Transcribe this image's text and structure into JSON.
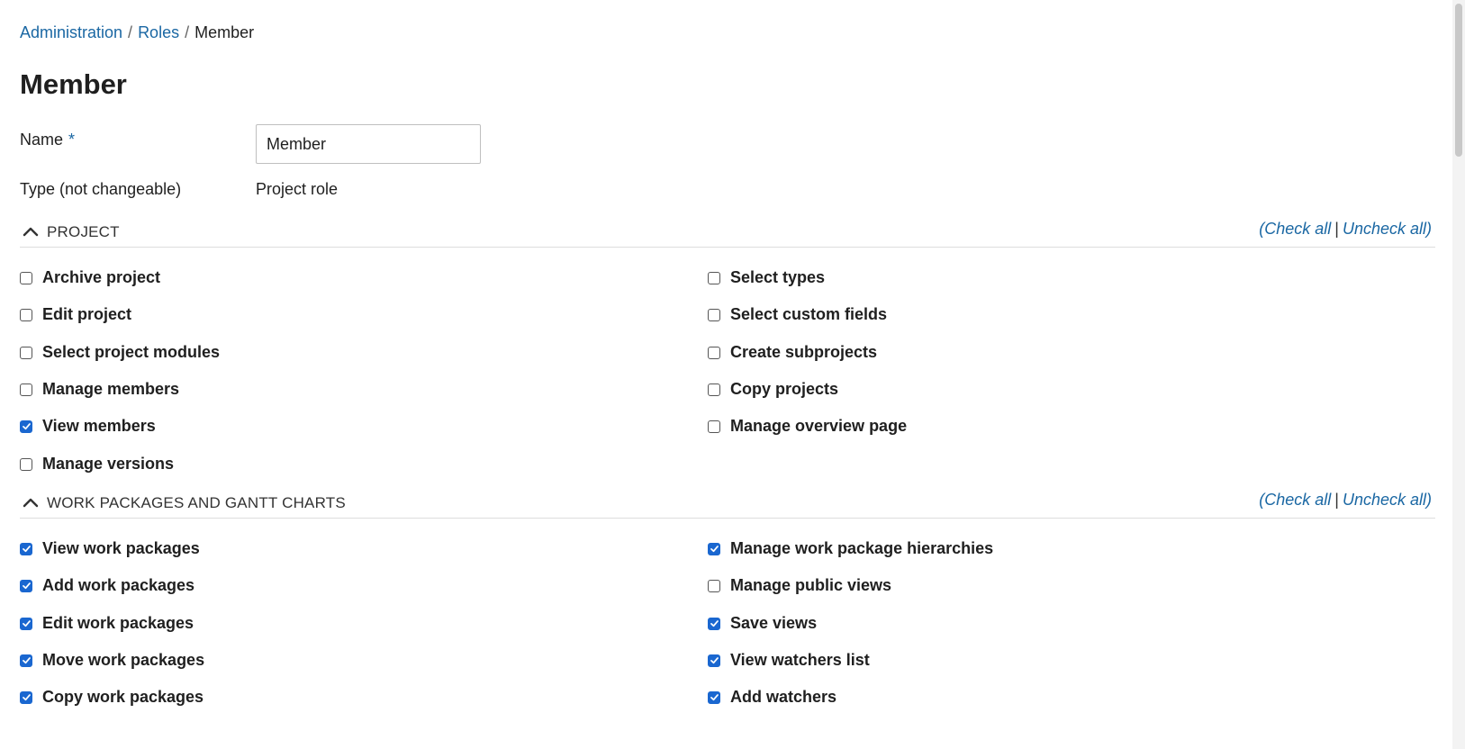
{
  "breadcrumb": {
    "items": [
      "Administration",
      "Roles"
    ],
    "current": "Member"
  },
  "page_title": "Member",
  "form": {
    "name_label": "Name",
    "required_mark": "*",
    "name_value": "Member",
    "type_label": "Type (not changeable)",
    "type_value": "Project role"
  },
  "check_all_label": "Check all",
  "uncheck_all_label": "Uncheck all",
  "sections": [
    {
      "title": "PROJECT",
      "left": [
        {
          "label": "Archive project",
          "checked": false
        },
        {
          "label": "Edit project",
          "checked": false
        },
        {
          "label": "Select project modules",
          "checked": false
        },
        {
          "label": "Manage members",
          "checked": false
        },
        {
          "label": "View members",
          "checked": true
        },
        {
          "label": "Manage versions",
          "checked": false
        }
      ],
      "right": [
        {
          "label": "Select types",
          "checked": false
        },
        {
          "label": "Select custom fields",
          "checked": false
        },
        {
          "label": "Create subprojects",
          "checked": false
        },
        {
          "label": "Copy projects",
          "checked": false
        },
        {
          "label": "Manage overview page",
          "checked": false
        }
      ]
    },
    {
      "title": "WORK PACKAGES AND GANTT CHARTS",
      "left": [
        {
          "label": "View work packages",
          "checked": true
        },
        {
          "label": "Add work packages",
          "checked": true
        },
        {
          "label": "Edit work packages",
          "checked": true
        },
        {
          "label": "Move work packages",
          "checked": true
        },
        {
          "label": "Copy work packages",
          "checked": true
        }
      ],
      "right": [
        {
          "label": "Manage work package hierarchies",
          "checked": true
        },
        {
          "label": "Manage public views",
          "checked": false
        },
        {
          "label": "Save views",
          "checked": true
        },
        {
          "label": "View watchers list",
          "checked": true
        },
        {
          "label": "Add watchers",
          "checked": true
        }
      ]
    }
  ],
  "colors": {
    "link": "#1a67a3",
    "checkbox_checked": "#1a67d0"
  }
}
